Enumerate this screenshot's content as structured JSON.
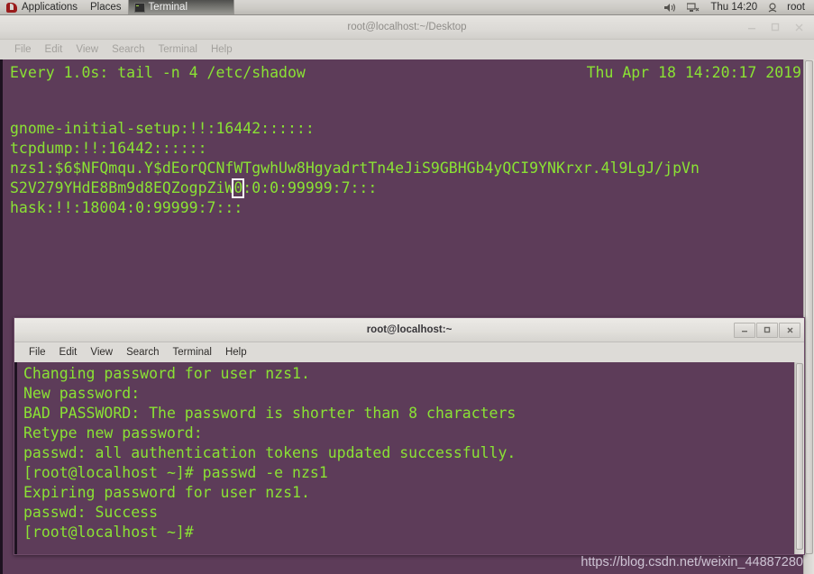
{
  "top_panel": {
    "applications_label": "Applications",
    "places_label": "Places",
    "task_label": "Terminal",
    "clock": "Thu 14:20",
    "user": "root",
    "icons": {
      "fedora": "fedora-logo-icon",
      "task": "terminal-icon",
      "volume": "volume-icon",
      "network": "network-icon",
      "user": "user-icon"
    }
  },
  "outer_window": {
    "title": "root@localhost:~/Desktop",
    "menu": [
      "File",
      "Edit",
      "View",
      "Search",
      "Terminal",
      "Help"
    ],
    "controls": {
      "minimize": "–",
      "maximize": "□",
      "close": "✕"
    },
    "watch": {
      "interval_label": "Every 1.0s: tail -n 4 /etc/shadow",
      "timestamp": "Thu Apr 18 14:20:17 2019"
    },
    "lines": [
      "gnome-initial-setup:!!:16442::::::",
      "tcpdump:!!:16442::::::",
      "nzs1:$6$NFQmqu.Y$dEorQCNfWTgwhUw8HgyadrtTn4eJiS9GBHGb4yQCI9YNKrxr.4l9LgJ/jpVn",
      "hask:!!:18004:0:99999:7:::"
    ],
    "wrapped_line": {
      "before_cursor": "S2V279YHdE8Bm9d8EQZogpZiW",
      "cursor_char": "0",
      "after_cursor": ":0:0:99999:7:::"
    }
  },
  "inner_window": {
    "title": "root@localhost:~",
    "menu": [
      "File",
      "Edit",
      "View",
      "Search",
      "Terminal",
      "Help"
    ],
    "controls": {
      "minimize": "–",
      "maximize": "□",
      "close": "✕"
    },
    "lines": [
      "Changing password for user nzs1.",
      "New password:",
      "BAD PASSWORD: The password is shorter than 8 characters",
      "Retype new password:",
      "passwd: all authentication tokens updated successfully.",
      "[root@localhost ~]# passwd -e nzs1",
      "Expiring password for user nzs1.",
      "passwd: Success",
      "[root@localhost ~]#"
    ]
  },
  "watermark": "https://blog.csdn.net/weixin_44887280",
  "colors": {
    "terminal_background": "#5d3c59",
    "terminal_foreground": "#8ae234",
    "panel_background": "#d8d6d2",
    "cursor": "#ffffff"
  }
}
